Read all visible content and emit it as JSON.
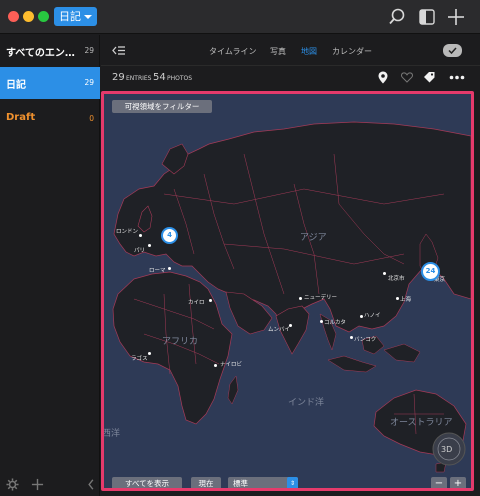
{
  "titlebar": {
    "journal_name": "日記",
    "icons": [
      "search-icon",
      "sidebar-toggle-icon",
      "plus-icon"
    ]
  },
  "sidebar": {
    "items": [
      {
        "label": "すべてのエン…",
        "count": "29"
      },
      {
        "label": "日記",
        "count": "29"
      },
      {
        "label": "Draft",
        "count": "0"
      }
    ],
    "colors": {
      "active": "#2c8fe6",
      "draft": "#f0912e"
    }
  },
  "header": {
    "tabs": [
      "タイムライン",
      "写真",
      "地図",
      "カレンダー"
    ],
    "active_tab": "地図"
  },
  "stats": {
    "entries_num": "29",
    "entries_label": "ENTRIES",
    "photos_num": "54",
    "photos_label": "PHOTOS"
  },
  "map": {
    "filter_button": "可視領域をフィルター",
    "show_all_button": "すべてを表示",
    "current_button": "現在",
    "map_type_value": "標準",
    "mode_3d": "3D",
    "zoom_out": "−",
    "zoom_in": "+",
    "regions": [
      "アジア",
      "アフリカ",
      "インド洋",
      "オーストラリア",
      "西洋"
    ],
    "cities": [
      "ロンドン",
      "パリ",
      "ローマ",
      "カイロ",
      "ラゴス",
      "ナイロビ",
      "ニューデリー",
      "ムンバイ",
      "コルカタ",
      "ハノイ",
      "バンコク",
      "北京市",
      "上海",
      "東京"
    ],
    "clusters": [
      "4",
      "24"
    ],
    "accent_color": "#2c8fe6",
    "border_color": "#e53a6b"
  }
}
